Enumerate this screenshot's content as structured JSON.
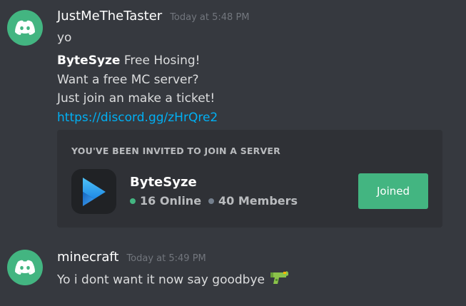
{
  "messages": [
    {
      "username": "JustMeTheTaster",
      "timestamp": "Today at 5:48 PM",
      "lines": {
        "yo": "yo",
        "bold_name": "ByteSyze",
        "line1_rest": " Free Hosing!",
        "line2": "Want a free MC server?",
        "line3": "Just join an make a ticket!",
        "link": "https://discord.gg/zHrQre2"
      },
      "invite": {
        "title": "YOU'VE BEEN INVITED TO JOIN A SERVER",
        "server_name": "ByteSyze",
        "online": "16 Online",
        "members": "40 Members",
        "button_label": "Joined",
        "icon": "bytesyze-play-icon"
      }
    },
    {
      "username": "minecraft",
      "timestamp": "Today at 5:49 PM",
      "text": "Yo i dont want it now say goodbye",
      "emoji": "water-gun-icon"
    }
  ],
  "colors": {
    "background": "#36393f",
    "embed_background": "#2f3136",
    "avatar": "#43b581",
    "link": "#00b0f4",
    "online": "#43b581",
    "button": "#43b581"
  }
}
